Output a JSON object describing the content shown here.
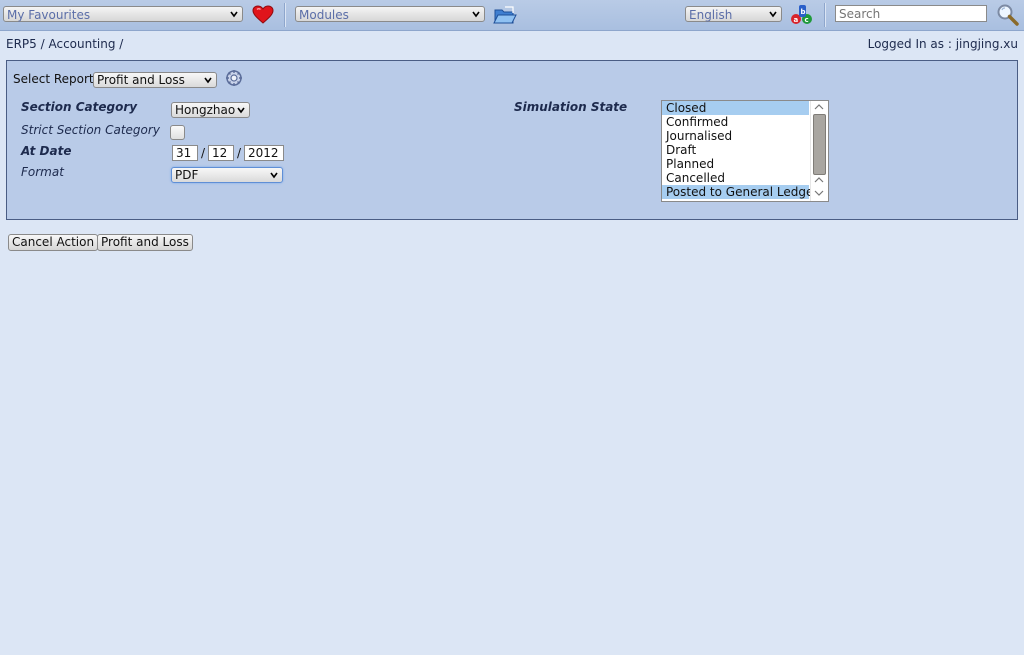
{
  "topbar": {
    "favourites_label": "My Favourites",
    "modules_label": "Modules",
    "language_label": "English",
    "search_placeholder": "Search"
  },
  "breadcrumb": {
    "items": [
      "ERP5",
      "Accounting"
    ],
    "separator": " / "
  },
  "user": {
    "logged_in_text": "Logged In as : jingjing.xu"
  },
  "report": {
    "select_label": "Select Report",
    "selected_report": "Profit and Loss"
  },
  "form": {
    "section_category_label": "Section Category",
    "section_category_value": "Hongzhao",
    "strict_section_label": "Strict Section Category",
    "strict_section_checked": false,
    "at_date_label": "At Date",
    "at_date_day": "31",
    "at_date_month": "12",
    "at_date_year": "2012",
    "date_separator": "/",
    "format_label": "Format",
    "format_value": "PDF",
    "simulation_state_label": "Simulation State",
    "simulation_state_options": [
      {
        "label": "Closed",
        "selected": true
      },
      {
        "label": "Confirmed",
        "selected": false
      },
      {
        "label": "Journalised",
        "selected": false
      },
      {
        "label": "Draft",
        "selected": false
      },
      {
        "label": "Planned",
        "selected": false
      },
      {
        "label": "Cancelled",
        "selected": false
      },
      {
        "label": "Posted to General Ledger",
        "selected": true
      }
    ]
  },
  "actions": {
    "cancel_label": "Cancel Action",
    "submit_label": "Profit and Loss"
  },
  "colors": {
    "background": "#dce6f5",
    "panel": "#b9cbe8",
    "selected_option": "#a6cdf0",
    "topbar": "#b9cbe6"
  }
}
